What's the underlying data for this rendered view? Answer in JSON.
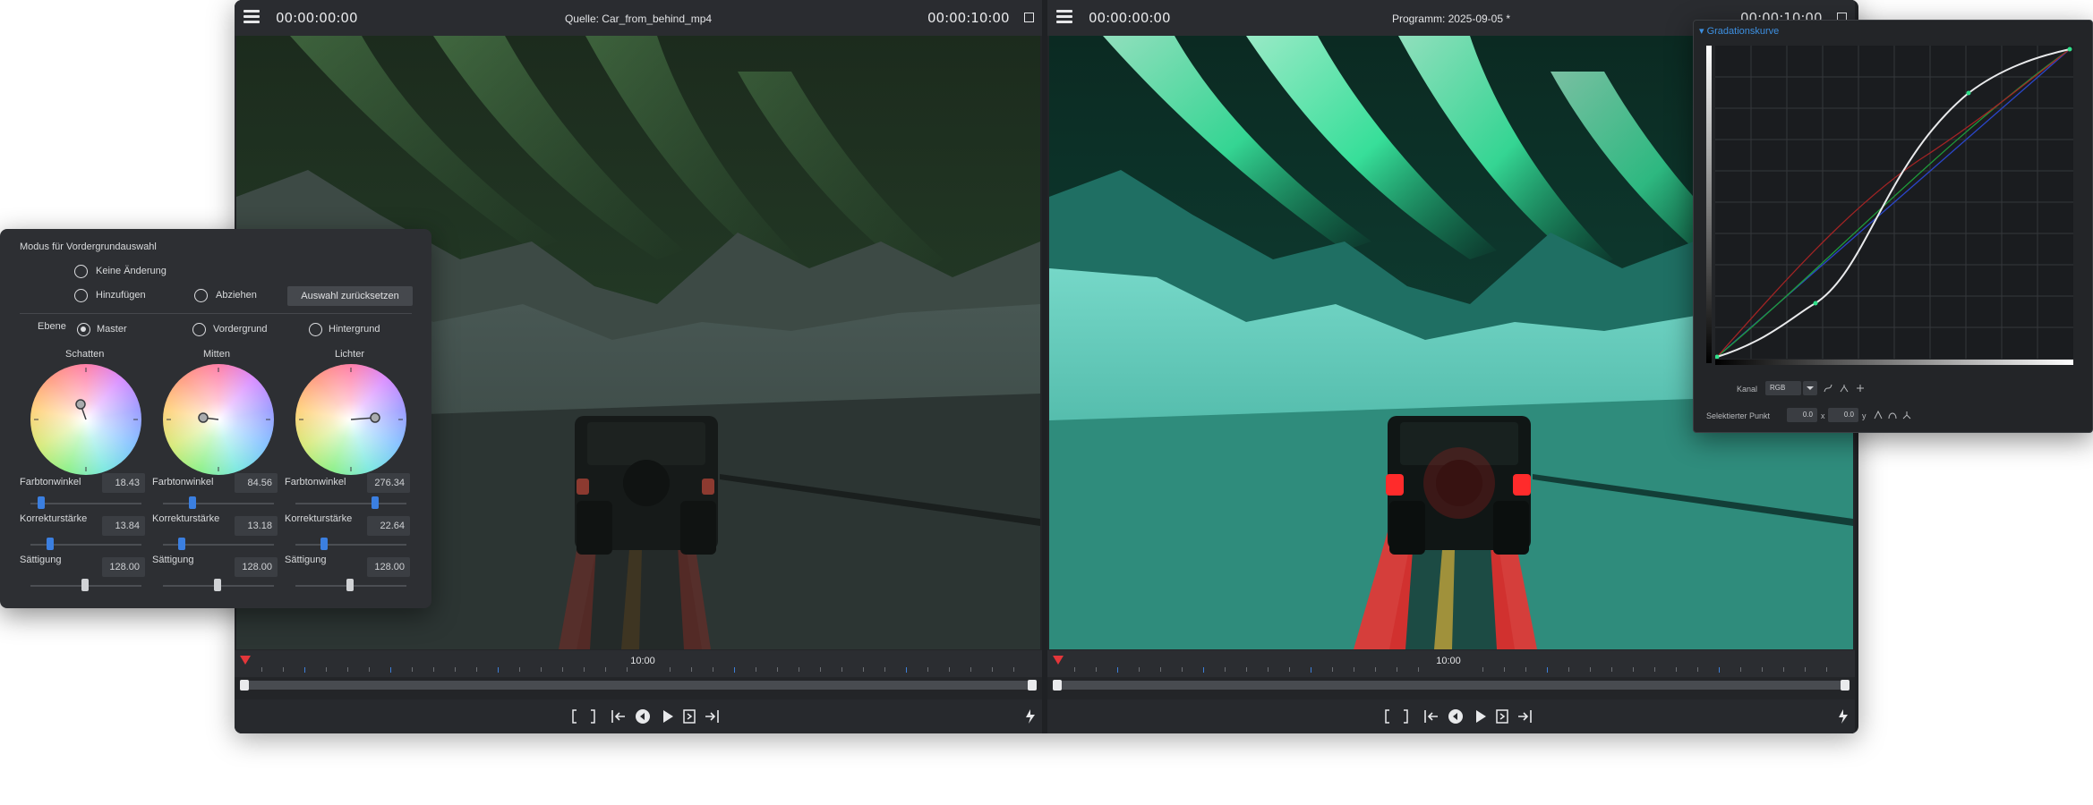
{
  "source_monitor": {
    "timecode_start": "00:00:00:00",
    "title": "Quelle: Car_from_behind_mp4",
    "timecode_end": "00:00:10:00",
    "ruler_label": "10:00"
  },
  "program_monitor": {
    "timecode_start": "00:00:00:00",
    "title": "Programm: 2025-09-05 *",
    "timecode_end": "00:00:10:00",
    "ruler_label": "10:00"
  },
  "color_panel": {
    "mode_title": "Modus für Vordergrundauswahl",
    "options": {
      "no_change": "Keine Änderung",
      "add": "Hinzufügen",
      "subtract": "Abziehen",
      "reset_button": "Auswahl zurücksetzen"
    },
    "layer_label": "Ebene",
    "layers": [
      "Master",
      "Vordergrund",
      "Hintergrund"
    ],
    "selected_layer": "Master",
    "wheels": [
      {
        "name": "Schatten",
        "hue_label": "Farbtonwinkel",
        "hue": "18.43",
        "strength_label": "Korrekturstärke",
        "strength": "13.84",
        "saturation_label": "Sättigung",
        "saturation": "128.00"
      },
      {
        "name": "Mitten",
        "hue_label": "Farbtonwinkel",
        "hue": "84.56",
        "strength_label": "Korrekturstärke",
        "strength": "13.18",
        "saturation_label": "Sättigung",
        "saturation": "128.00"
      },
      {
        "name": "Lichter",
        "hue_label": "Farbtonwinkel",
        "hue": "276.34",
        "strength_label": "Korrekturstärke",
        "strength": "22.64",
        "saturation_label": "Sättigung",
        "saturation": "128.00"
      }
    ]
  },
  "curves_panel": {
    "title": "Gradationskurve",
    "channel_label": "Kanal",
    "channel_value": "RGB",
    "selected_point_label": "Selektierter Punkt",
    "point_x": "0.0",
    "x_label": "x",
    "point_y": "0.0",
    "y_label": "y"
  },
  "colors": {
    "accent_blue": "#3d8fe0",
    "playhead_red": "#e4363a",
    "panel_bg": "#2d2f33",
    "window_bg": "#1f2124"
  }
}
